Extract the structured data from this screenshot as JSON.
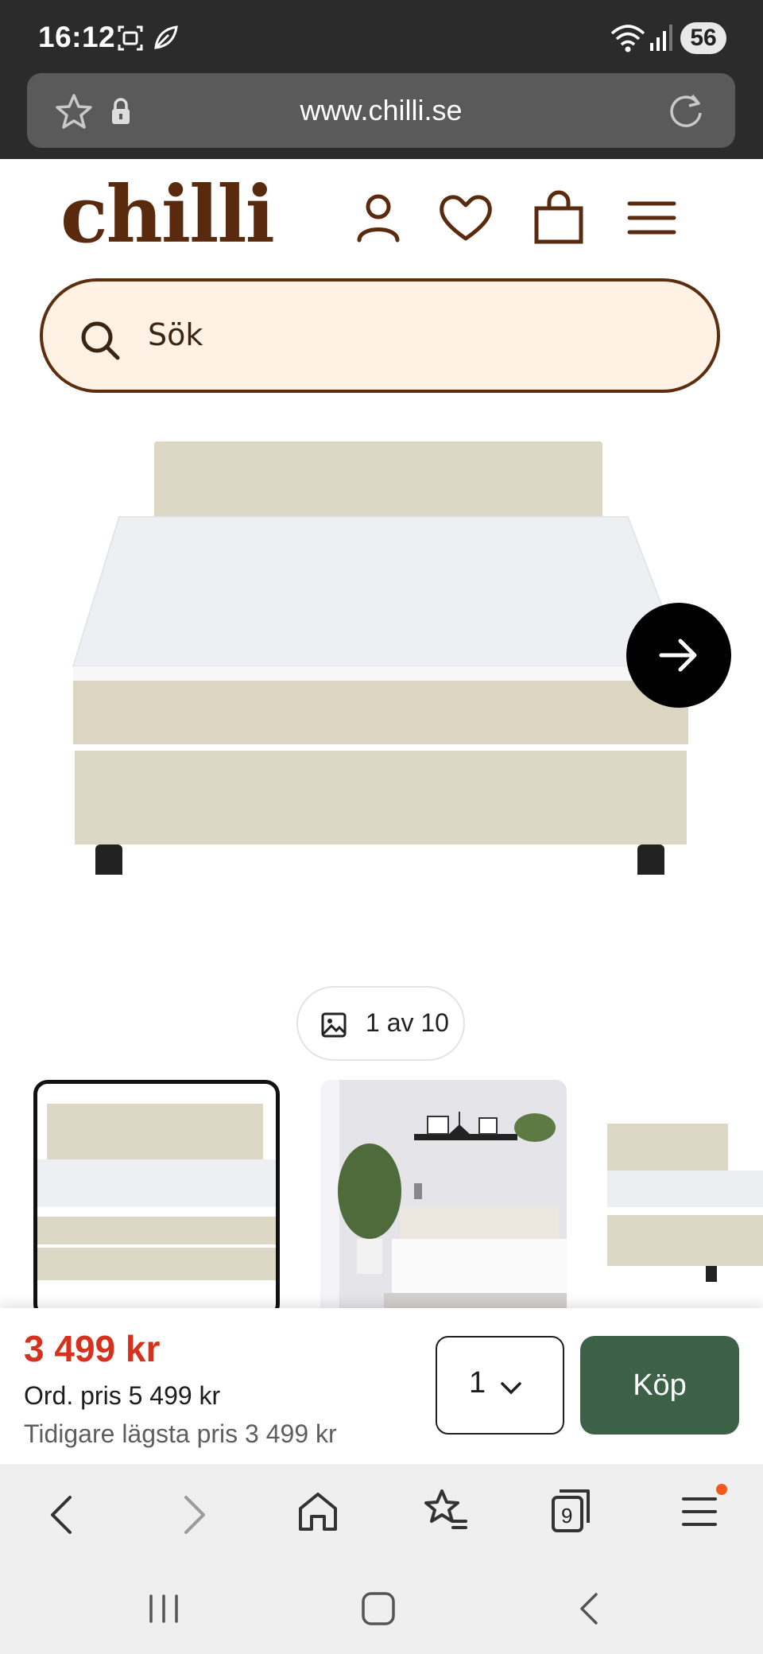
{
  "status_bar": {
    "time": "16:12",
    "battery": "56",
    "icons": [
      "screenshot-icon",
      "leaf-icon",
      "wifi-icon",
      "signal-icon",
      "battery-icon"
    ]
  },
  "browser": {
    "url": "www.chilli.se",
    "icons": [
      "star-icon",
      "lock-icon",
      "reload-icon"
    ]
  },
  "header": {
    "logo": "chilli",
    "icons": [
      "account-icon",
      "heart-icon",
      "bag-icon",
      "menu-icon"
    ],
    "brand_color": "#5a2a0e"
  },
  "search": {
    "placeholder": "Sök"
  },
  "gallery": {
    "counter": "1 av 10",
    "icons": [
      "arrow-right-icon",
      "image-icon"
    ]
  },
  "purchase": {
    "price": "3 499 kr",
    "ordinary_price": "Ord. pris 5 499 kr",
    "lowest_price": "Tidigare lägsta pris 3 499 kr",
    "quantity": "1",
    "buy_label": "Köp",
    "price_color": "#d5311c",
    "buy_color": "#3c6147"
  },
  "browser_nav": {
    "tabs_count": "9",
    "icons": [
      "back-icon",
      "forward-icon",
      "home-icon",
      "bookmarks-icon",
      "tabs-icon",
      "menu-icon"
    ]
  },
  "system_nav": {
    "icons": [
      "recents-icon",
      "home-button-icon",
      "back-icon"
    ]
  }
}
